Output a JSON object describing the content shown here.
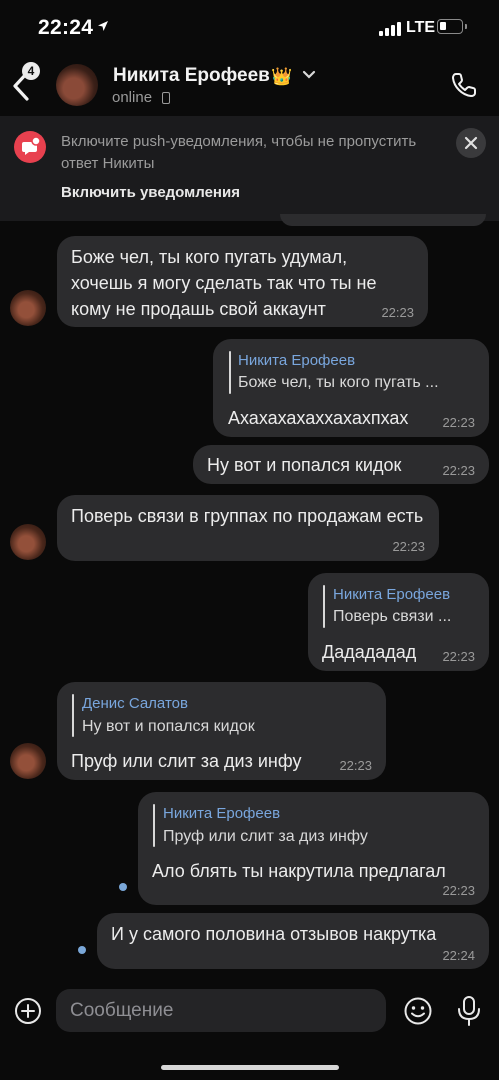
{
  "status_bar": {
    "time": "22:24",
    "network": "LTE",
    "battery_level": 0.2
  },
  "header": {
    "back_badge": "4",
    "contact_name": "Никита Ерофеев",
    "crown": "👑",
    "status": "online",
    "icons": [
      "back-chevron-icon",
      "chevron-down-icon",
      "phone-call-icon",
      "mobile-device-icon"
    ]
  },
  "notice": {
    "text": "Включите push-уведомления, чтобы не пропустить ответ Никиты",
    "action": "Включить уведомления"
  },
  "messages": [
    {
      "text": "Боже чел, ты кого пугать удумал, хочешь я могу сделать так что ты не кому не продашь свой аккаунт",
      "time": "22:23"
    },
    {
      "reply_name": "Никита Ерофеев",
      "reply_text": "Боже чел, ты кого пугать ...",
      "text": "Ахахахахаххахахпхах",
      "time": "22:23"
    },
    {
      "text": "Ну вот и попался кидок",
      "time": "22:23"
    },
    {
      "text": "Поверь связи в группах по продажам есть",
      "time": "22:23"
    },
    {
      "reply_name": "Никита Ерофеев",
      "reply_text": "Поверь связи ...",
      "text": "Дадададад",
      "time": "22:23"
    },
    {
      "reply_name": "Денис Салатов",
      "reply_text": "Ну вот и попался кидок",
      "text": "Пруф или слит за диз инфу",
      "time": "22:23"
    },
    {
      "reply_name": "Никита Ерофеев",
      "reply_text": "Пруф или слит за диз инфу",
      "text": "Ало блять ты накрутила предлагал",
      "time": "22:23"
    },
    {
      "text": "И у самого половина отзывов накрутка",
      "time": "22:24"
    }
  ],
  "composer": {
    "placeholder": "Сообщение"
  },
  "colors": {
    "background": "#0a0a0a",
    "bubble": "#2c2c2e",
    "reply_name": "#79a6dd",
    "notice_icon": "#e8414f",
    "unread_dot": "#7aa7d8"
  }
}
